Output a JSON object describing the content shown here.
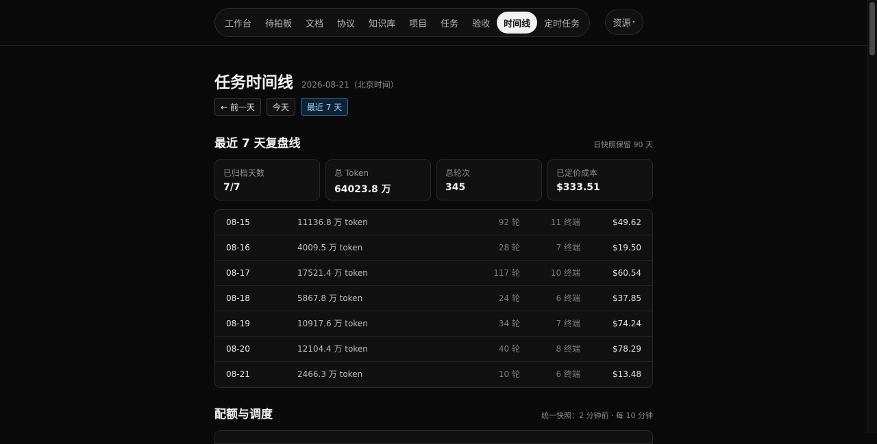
{
  "nav": {
    "items": [
      {
        "label": "工作台",
        "active": false
      },
      {
        "label": "待拍板",
        "active": false
      },
      {
        "label": "文档",
        "active": false
      },
      {
        "label": "协议",
        "active": false
      },
      {
        "label": "知识库",
        "active": false
      },
      {
        "label": "项目",
        "active": false
      },
      {
        "label": "任务",
        "active": false
      },
      {
        "label": "验收",
        "active": false
      },
      {
        "label": "时间线",
        "active": true
      },
      {
        "label": "定时任务",
        "active": false
      }
    ],
    "resources_label": "资源",
    "resources_icon": "chevron-dot-icon"
  },
  "page": {
    "title": "任务时间线",
    "date": "2026-08-21（北京时间）"
  },
  "buttons": {
    "prev_day": "← 前一天",
    "today": "今天",
    "last7": "最近 7 天"
  },
  "review": {
    "title": "最近 7 天复盘线",
    "note": "日快照保留 90 天",
    "stats": [
      {
        "label": "已归档天数",
        "value": "7/7"
      },
      {
        "label": "总 Token",
        "value": "64023.8 万"
      },
      {
        "label": "总轮次",
        "value": "345"
      },
      {
        "label": "已定价成本",
        "value": "$333.51"
      }
    ],
    "rows": [
      {
        "date": "08-15",
        "tokens": "11136.8 万 token",
        "rounds": "92 轮",
        "terminals": "11 终端",
        "cost": "$49.62"
      },
      {
        "date": "08-16",
        "tokens": "4009.5 万 token",
        "rounds": "28 轮",
        "terminals": "7 终端",
        "cost": "$19.50"
      },
      {
        "date": "08-17",
        "tokens": "17521.4 万 token",
        "rounds": "117 轮",
        "terminals": "10 终端",
        "cost": "$60.54"
      },
      {
        "date": "08-18",
        "tokens": "5867.8 万 token",
        "rounds": "24 轮",
        "terminals": "6 终端",
        "cost": "$37.85"
      },
      {
        "date": "08-19",
        "tokens": "10917.6 万 token",
        "rounds": "34 轮",
        "terminals": "7 终端",
        "cost": "$74.24"
      },
      {
        "date": "08-20",
        "tokens": "12104.4 万 token",
        "rounds": "40 轮",
        "terminals": "8 终端",
        "cost": "$78.29"
      },
      {
        "date": "08-21",
        "tokens": "2466.3 万 token",
        "rounds": "10 轮",
        "terminals": "6 终端",
        "cost": "$13.48"
      }
    ]
  },
  "quota": {
    "title": "配额与调度",
    "note": "统一快照：2 分钟前 · 每 10 分钟"
  }
}
